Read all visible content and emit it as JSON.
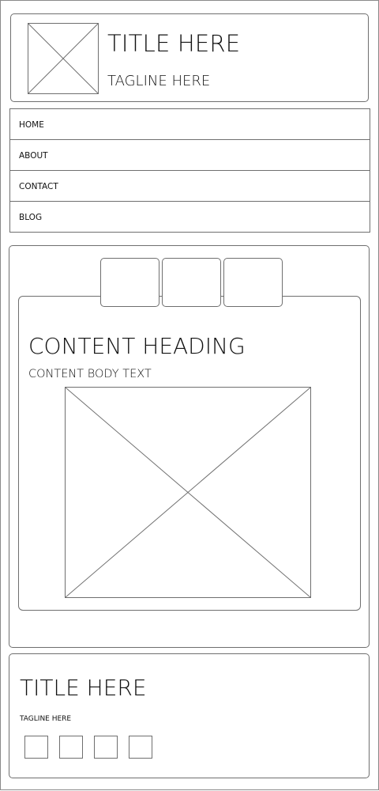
{
  "header": {
    "title": "TITLE HERE",
    "tagline": "TAGLINE HERE",
    "image_icon": "image-placeholder-icon"
  },
  "nav": {
    "items": [
      {
        "label": "HOME"
      },
      {
        "label": "ABOUT"
      },
      {
        "label": "CONTACT"
      },
      {
        "label": "BLOG"
      }
    ]
  },
  "content": {
    "tabs": [
      {
        "label": ""
      },
      {
        "label": ""
      },
      {
        "label": ""
      }
    ],
    "heading": "CONTENT HEADING",
    "body": "CONTENT BODY TEXT",
    "image_icon": "image-placeholder-icon"
  },
  "footer": {
    "title": "TITLE HERE",
    "tagline": "TAGLINE HERE",
    "social_icons": [
      "social-icon-1",
      "social-icon-2",
      "social-icon-3",
      "social-icon-4"
    ]
  },
  "colors": {
    "stroke": "#6f6f6f",
    "background": "#ffffff",
    "text": "#111111"
  }
}
